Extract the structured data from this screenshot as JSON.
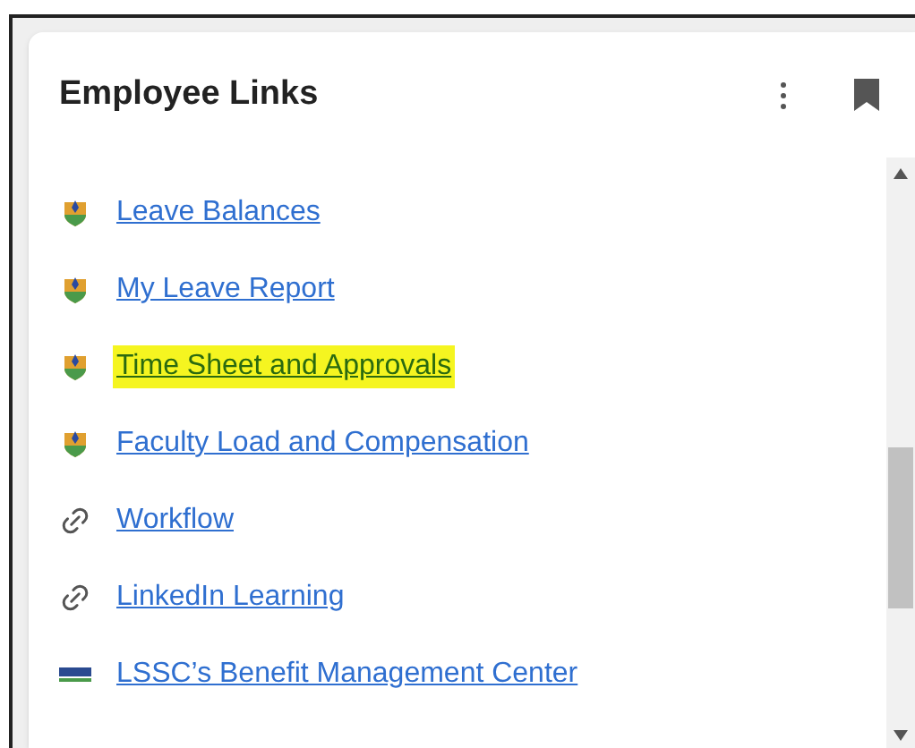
{
  "card": {
    "title": "Employee Links"
  },
  "links": [
    {
      "label": "Leave Balances",
      "kind": "shield",
      "highlighted": false
    },
    {
      "label": "My Leave Report",
      "kind": "shield",
      "highlighted": false
    },
    {
      "label": "Time Sheet and Approvals",
      "kind": "shield",
      "highlighted": true
    },
    {
      "label": "Faculty Load and Compensation",
      "kind": "shield",
      "highlighted": false
    },
    {
      "label": "Workflow",
      "kind": "link",
      "highlighted": false
    },
    {
      "label": "LinkedIn Learning",
      "kind": "link",
      "highlighted": false
    },
    {
      "label": "LSSC’s Benefit Management Center",
      "kind": "logo",
      "highlighted": false
    }
  ]
}
